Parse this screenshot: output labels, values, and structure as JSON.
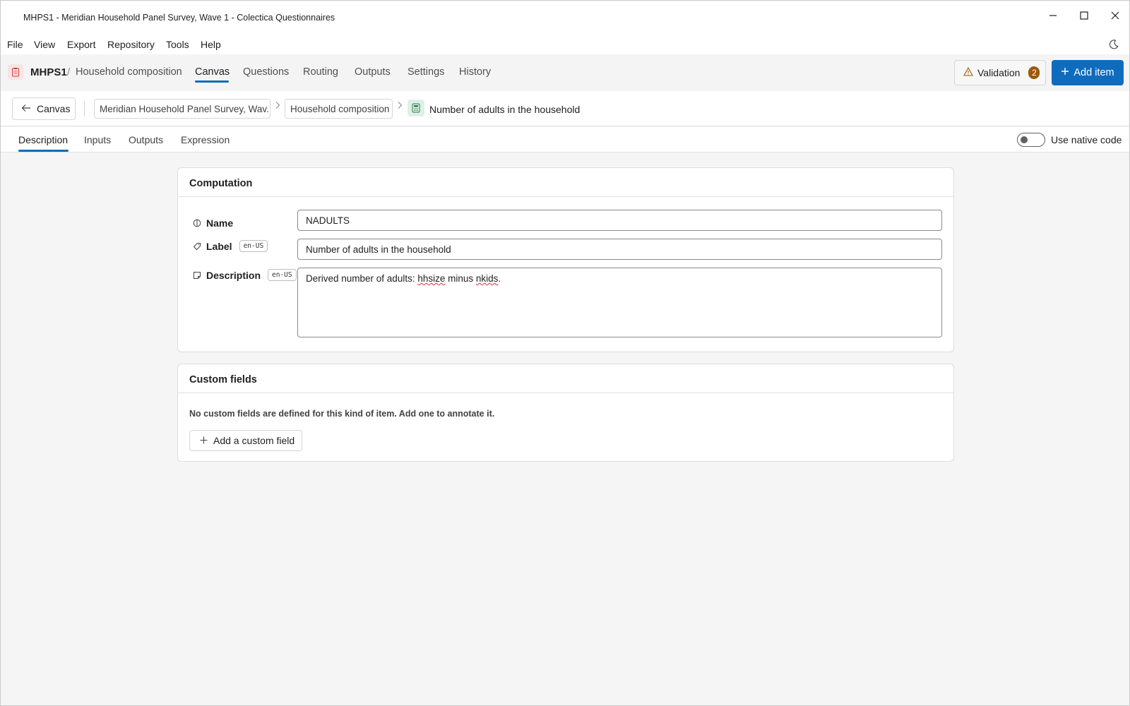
{
  "window": {
    "title": "MHPS1 - Meridian Household Panel Survey, Wave 1 - Colectica Questionnaires",
    "controls": [
      "minimize-icon",
      "maximize-icon",
      "close-icon"
    ]
  },
  "menu": {
    "items": [
      "File",
      "View",
      "Export",
      "Repository",
      "Tools",
      "Help"
    ],
    "theme_icon": "moon-icon"
  },
  "appbar": {
    "code": "MHPS1",
    "separator": "/",
    "section": "Household composition",
    "tabs": [
      "Canvas",
      "Questions",
      "Routing",
      "Outputs",
      "Settings",
      "History"
    ],
    "active_tab": "Canvas",
    "validation_label": "Validation",
    "validation_count": "2",
    "add_item_label": "Add item"
  },
  "breadcrumb": {
    "back_label": "Canvas",
    "survey": "Meridian Household Panel Survey, Wav...",
    "section": "Household composition",
    "current": "Number of adults in the household"
  },
  "subtabs": {
    "items": [
      "Description",
      "Inputs",
      "Outputs",
      "Expression"
    ],
    "active": "Description",
    "native_code_label": "Use native code",
    "native_code_on": false
  },
  "computation": {
    "heading": "Computation",
    "name_label": "Name",
    "name_value": "NADULTS",
    "label_label": "Label",
    "label_lang": "en-US",
    "label_value": "Number of adults in the household",
    "description_label": "Description",
    "description_lang": "en-US",
    "description_prefix": "Derived number of adults: ",
    "description_word1": "hhsize",
    "description_middle": " minus ",
    "description_word2": "nkids",
    "description_suffix": "."
  },
  "custom_fields": {
    "heading": "Custom fields",
    "empty_note": "No custom fields are defined for this kind of item. Add one to annotate it.",
    "add_label": "Add a custom field"
  },
  "colors": {
    "accent": "#0f6cbd",
    "badge": "#9c5a0a",
    "spell_error": "#d13438"
  }
}
